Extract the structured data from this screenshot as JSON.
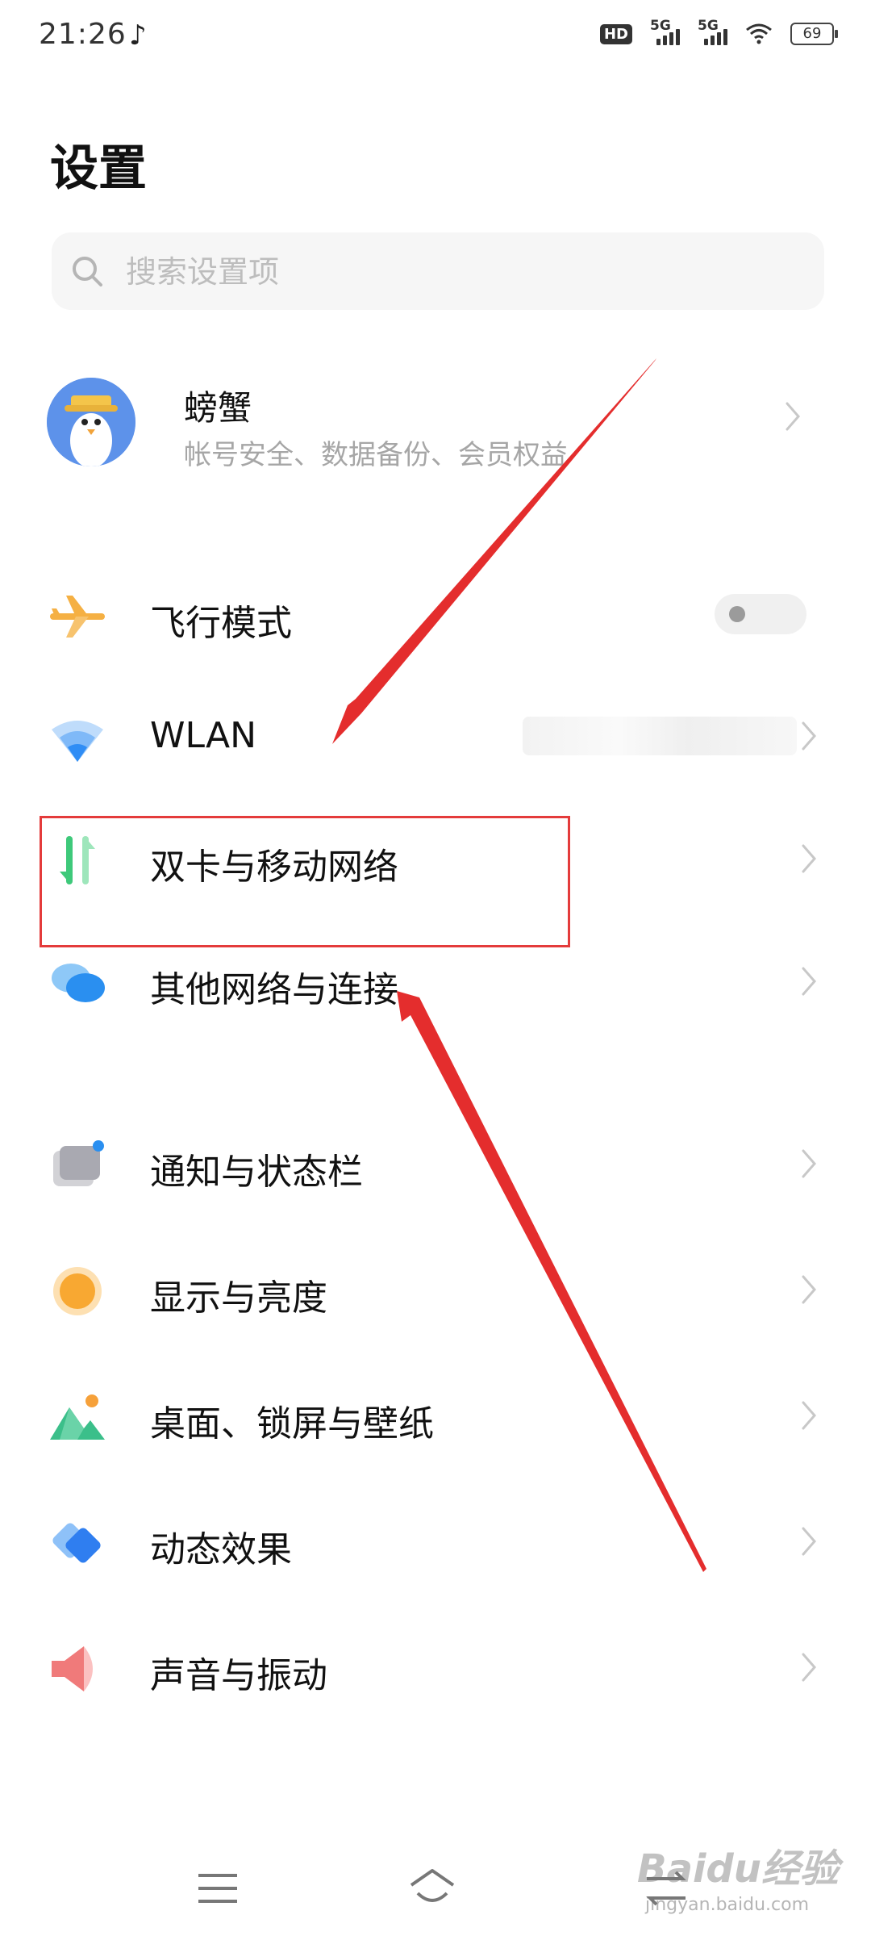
{
  "status_bar": {
    "time": "21:26",
    "hd_label": "HD",
    "sim1_label": "5G",
    "sim2_label": "5G",
    "battery": "69"
  },
  "page_title": "设置",
  "search": {
    "placeholder": "搜索设置项",
    "value": ""
  },
  "account": {
    "name": "螃蟹",
    "subtitle": "帐号安全、数据备份、会员权益"
  },
  "settings": [
    {
      "label": "飞行模式",
      "icon": "airplane-icon",
      "control": "toggle",
      "toggle_on": false
    },
    {
      "label": "WLAN",
      "icon": "wifi-icon",
      "control": "chevron"
    },
    {
      "label": "双卡与移动网络",
      "icon": "dual-sim-data-icon",
      "control": "chevron"
    },
    {
      "label": "其他网络与连接",
      "icon": "connections-icon",
      "control": "chevron"
    },
    {
      "label": "通知与状态栏",
      "icon": "notification-icon",
      "control": "chevron"
    },
    {
      "label": "显示与亮度",
      "icon": "brightness-icon",
      "control": "chevron"
    },
    {
      "label": "桌面、锁屏与壁纸",
      "icon": "wallpaper-icon",
      "control": "chevron"
    },
    {
      "label": "动态效果",
      "icon": "animation-icon",
      "control": "chevron"
    },
    {
      "label": "声音与振动",
      "icon": "sound-icon",
      "control": "chevron"
    }
  ],
  "nav_bar": [
    "menu-icon",
    "home-icon",
    "back-icon"
  ],
  "watermark": {
    "text": "Baidu经验",
    "sub": "jingyan.baidu.com"
  },
  "colors": {
    "annotation_red": "#e43b3b",
    "airplane": "#f5b043",
    "wifi": "#2f8df5",
    "dual_sim": "#3ec97a",
    "link": "#2a8ff0"
  }
}
